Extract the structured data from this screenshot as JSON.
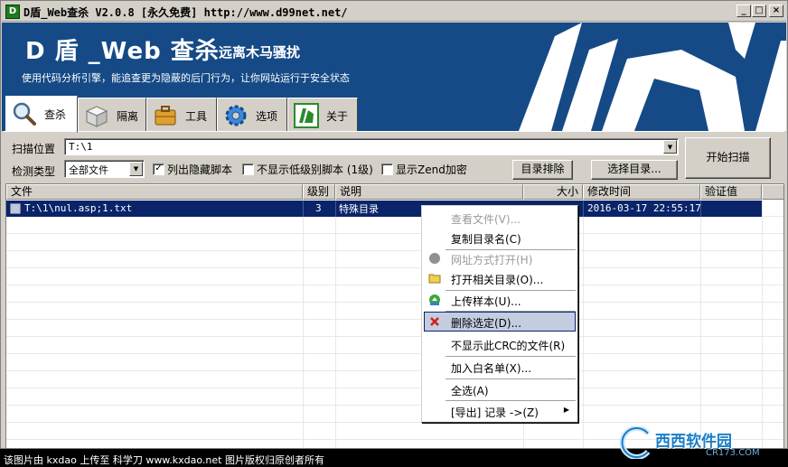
{
  "window": {
    "title": "D盾_Web查杀 V2.0.8 [永久免费] http://www.d99net.net/",
    "icon_text": "D",
    "buttons": {
      "minimize": "_",
      "maximize": "□",
      "close": "×"
    }
  },
  "banner": {
    "brand": "D 盾 _Web 查杀",
    "subtitle": "远离木马骚扰",
    "slogan": "使用代码分析引擎，能追查更为隐蔽的后门行为，让你网站运行于安全状态"
  },
  "tabs": [
    {
      "label": "查杀",
      "icon": "magnifier-icon"
    },
    {
      "label": "隔离",
      "icon": "box-icon"
    },
    {
      "label": "工具",
      "icon": "briefcase-icon"
    },
    {
      "label": "选项",
      "icon": "gear-icon"
    },
    {
      "label": "关于",
      "icon": "d-logo-icon"
    }
  ],
  "scan": {
    "path_label": "扫描位置",
    "path_value": "T:\\1",
    "type_label": "检测类型",
    "type_value": "全部文件",
    "opt_hidden": "列出隐藏脚本",
    "opt_hidden_checked": true,
    "opt_lowlevel": "不显示低级别脚本 (1级)",
    "opt_lowlevel_checked": false,
    "opt_zend": "显示Zend加密",
    "opt_zend_checked": false,
    "exclude_btn": "目录排除",
    "choose_btn": "选择目录...",
    "start_btn": "开始扫描"
  },
  "list": {
    "columns": [
      "文件",
      "级别",
      "说明",
      "大小",
      "修改时间",
      "验证值"
    ],
    "rows": [
      {
        "file": "T:\\1\\nul.asp;1.txt",
        "level": "3",
        "desc": "特殊目录",
        "size": "",
        "mtime": "2016-03-17 22:55:17",
        "hash": ""
      }
    ]
  },
  "context_menu": {
    "items": [
      {
        "label": "查看文件(V)...",
        "disabled": true,
        "icon": ""
      },
      {
        "label": "复制目录名(C)",
        "disabled": false,
        "icon": ""
      },
      {
        "label": "网址方式打开(H)",
        "disabled": true,
        "icon": "globe-icon"
      },
      {
        "label": "打开相关目录(O)...",
        "disabled": false,
        "icon": "folder-icon"
      },
      {
        "label": "上传样本(U)...",
        "disabled": false,
        "icon": "upload-icon"
      },
      {
        "label": "删除选定(D)...",
        "disabled": false,
        "icon": "delete-icon",
        "hover": true
      },
      {
        "label": "不显示此CRC的文件(R)",
        "disabled": false,
        "icon": ""
      },
      {
        "label": "加入白名单(X)...",
        "disabled": false,
        "icon": ""
      },
      {
        "label": "全选(A)",
        "disabled": false,
        "icon": ""
      },
      {
        "label": "[导出] 记录 ->(Z)",
        "disabled": false,
        "icon": "",
        "submenu": true
      }
    ]
  },
  "footer": {
    "credit": "该图片由 kxdao 上传至 科学刀 www.kxdao.net 图片版权归原创者所有",
    "watermark": "西西软件园",
    "watermark_sub": "CR173.COM"
  },
  "colors": {
    "banner": "#154a86",
    "selection": "#0a246a",
    "face": "#d4d0c8"
  }
}
